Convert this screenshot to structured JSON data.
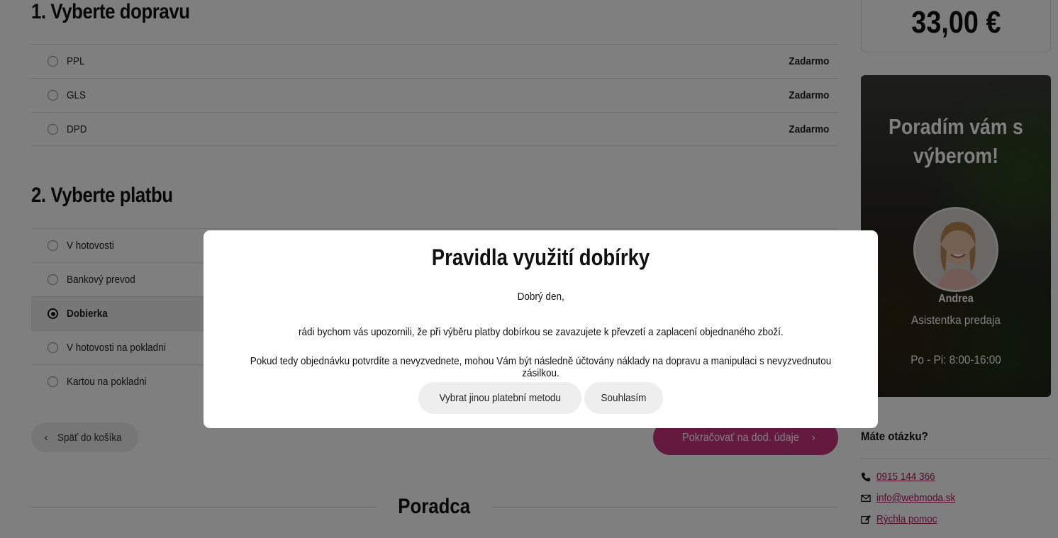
{
  "shipping": {
    "title": "1. Vyberte dopravu",
    "options": [
      {
        "label": "PPL",
        "price": "Zadarmo"
      },
      {
        "label": "GLS",
        "price": "Zadarmo"
      },
      {
        "label": "DPD",
        "price": "Zadarmo"
      }
    ]
  },
  "payment": {
    "title": "2. Vyberte platbu",
    "options": [
      {
        "label": "V hotovosti",
        "selected": false
      },
      {
        "label": "Bankový prevod",
        "selected": false
      },
      {
        "label": "Dobierka",
        "selected": true
      },
      {
        "label": "V hotovosti na pokladni",
        "selected": false
      },
      {
        "label": "Kartou na pokladni",
        "selected": false
      }
    ]
  },
  "nav": {
    "back_label": "Späť do košíka",
    "continue_label": "Pokračovať na dod. údaje"
  },
  "advisor_section": {
    "title": "Poradca"
  },
  "summary": {
    "total": "33,00 €"
  },
  "advisor_card": {
    "title": "Poradím vám s výberom!",
    "name": "Andrea",
    "role": "Asistentka predaja",
    "hours": "Po - Pi: 8:00-16:00"
  },
  "contact": {
    "question": "Máte otázku?",
    "phone": "0915 144 366",
    "email": "info@webmoda.sk",
    "help": "Rýchla pomoc"
  },
  "modal": {
    "title": "Pravidla využití dobírky",
    "greeting": "Dobrý den,",
    "paragraph1": "rádi bychom vás upozornili, že při výběru platby dobírkou se zavazujete k převzetí a zaplacení objednaného zboží.",
    "paragraph2": "Pokud tedy objednávku potvrdíte a nevyzvednete, mohou Vám být následně účtovány náklady na dopravu a manipulaci s nevyzvednutou zásilkou.",
    "other_method_label": "Vybrat jinou platební metodu",
    "agree_label": "Souhlasím"
  },
  "colors": {
    "accent": "#c8347f",
    "link": "#a8195f",
    "overlay": "rgba(0,0,0,0.5)"
  }
}
